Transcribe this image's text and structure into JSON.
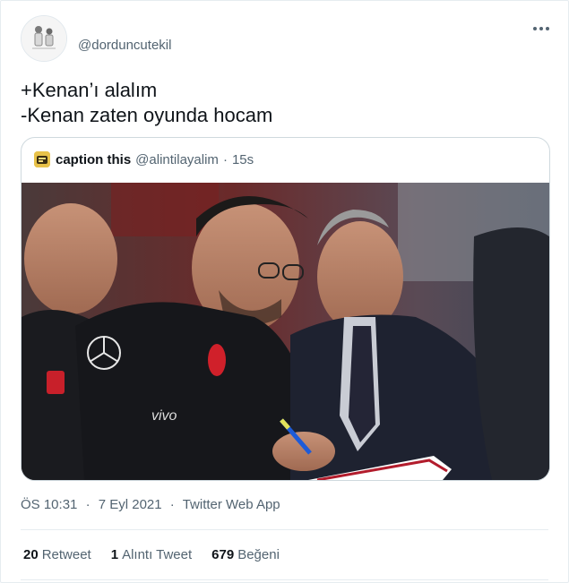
{
  "tweet": {
    "avatar_icon": "user-avatar-icon",
    "handle": "@dorduncutekil",
    "more_icon": "more-options-icon",
    "text_line1": "+Kenan’ı alalım",
    "text_line2": "-Kenan zaten oyunda hocam"
  },
  "quote": {
    "avatar_icon": "caption-this-avatar-icon",
    "name": "caption this",
    "handle": "@alintilayalim",
    "separator": "·",
    "time": "15s",
    "image_icon": "photo-two-men-writing-on-sideline"
  },
  "meta": {
    "time": "ÖS 10:31",
    "separator1": "·",
    "date": "7 Eyl 2021",
    "separator2": "·",
    "app": "Twitter Web App"
  },
  "stats": {
    "retweets_count": "20",
    "retweets_label": "Retweet",
    "quotes_count": "1",
    "quotes_label": "Alıntı Tweet",
    "likes_count": "679",
    "likes_label": "Beğeni"
  },
  "colors": {
    "text": "#0f1419",
    "secondary": "#536471",
    "border": "#cfd9de",
    "divider": "#e6ecf0"
  }
}
